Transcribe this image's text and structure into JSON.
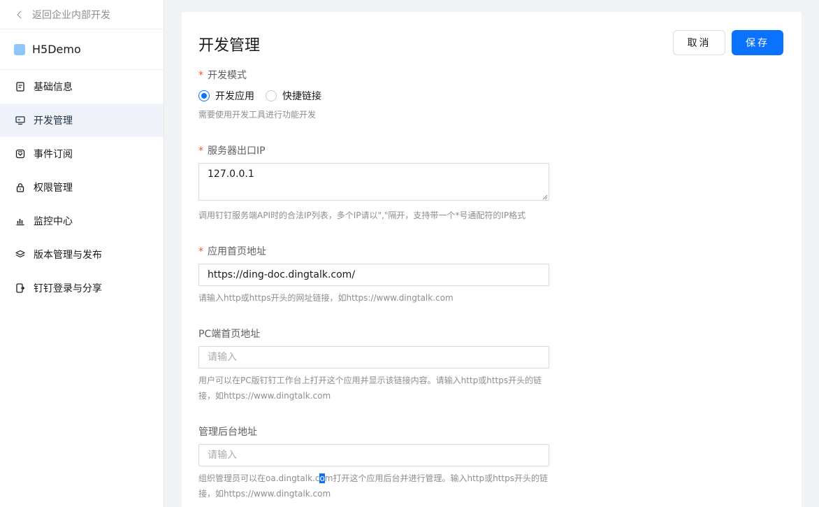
{
  "sidebar": {
    "back_label": "返回企业内部开发",
    "app_name": "H5Demo",
    "items": [
      {
        "label": "基础信息",
        "icon": "document-icon"
      },
      {
        "label": "开发管理",
        "icon": "monitor-icon"
      },
      {
        "label": "事件订阅",
        "icon": "subscribe-icon"
      },
      {
        "label": "权限管理",
        "icon": "lock-icon"
      },
      {
        "label": "监控中心",
        "icon": "bar-chart-icon"
      },
      {
        "label": "版本管理与发布",
        "icon": "layers-icon"
      },
      {
        "label": "钉钉登录与分享",
        "icon": "phone-share-icon"
      }
    ],
    "active_index": 1
  },
  "main": {
    "title": "开发管理",
    "cancel_label": "取消",
    "save_label": "保存",
    "dev_mode": {
      "label": "开发模式",
      "options": [
        "开发应用",
        "快捷链接"
      ],
      "selected": "开发应用",
      "hint": "需要使用开发工具进行功能开发"
    },
    "server_ip": {
      "label": "服务器出口IP",
      "value": "127.0.0.1",
      "hint": "调用钉钉服务端API时的合法IP列表，多个IP请以\",\"隔开，支持带一个*号通配符的IP格式"
    },
    "homepage": {
      "label": "应用首页地址",
      "value": "https://ding-doc.dingtalk.com/",
      "hint": "请输入http或https开头的网址链接，如https://www.dingtalk.com"
    },
    "pc_homepage": {
      "label": "PC端首页地址",
      "placeholder": "请输入",
      "hint": "用户可以在PC版钉钉工作台上打开这个应用并显示该链接内容。请输入http或https开头的链接，如https://www.dingtalk.com"
    },
    "admin_url": {
      "label": "管理后台地址",
      "placeholder": "请输入",
      "hint_before": "组织管理员可以在oa.dingtalk.c",
      "hint_selected": "o",
      "hint_after": "m打开这个应用后台并进行管理。输入http或https开头的链接，如https://www.dingtalk.com"
    }
  },
  "colors": {
    "primary": "#0a72ff",
    "required": "#ff5219",
    "active_nav_bg": "#f0f4fa"
  }
}
